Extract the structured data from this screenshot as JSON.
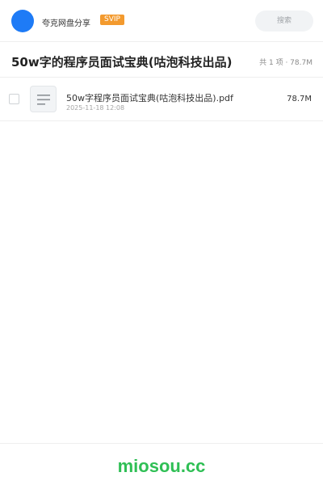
{
  "header": {
    "username": "夸克网盘分享",
    "badge": "SVIP",
    "search_placeholder": "搜索"
  },
  "share": {
    "title": "50w字的程序员面试宝典(咕泡科技出品)",
    "summary": "共 1 项 · 78.7M"
  },
  "files": [
    {
      "name": "50w字程序员面试宝典(咕泡科技出品).pdf",
      "date": "2025-11-18 12:08",
      "size": "78.7M",
      "icon": "document-icon"
    }
  ],
  "footer": {
    "brand": "miosou.cc"
  },
  "colors": {
    "avatar": "#1e7bf6",
    "svip_badge": "#f39a2e",
    "brand": "#2fbf55"
  }
}
